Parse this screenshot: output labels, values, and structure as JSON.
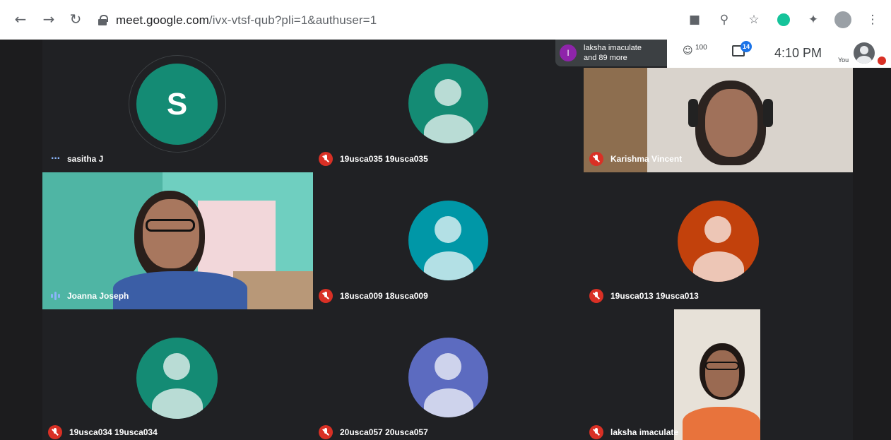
{
  "browser": {
    "url_host": "meet.google.com",
    "url_path": "/ivx-vtsf-qub?pli=1&authuser=1",
    "icons": [
      "back-arrow-icon",
      "forward-arrow-icon",
      "reload-icon",
      "lock-icon",
      "camera-icon",
      "zoom-icon",
      "star-icon",
      "grammarly-icon",
      "extensions-icon",
      "profile-icon",
      "menu-icon"
    ]
  },
  "meet": {
    "presenter": {
      "avatar_letter": "I",
      "line1": "laksha imaculate",
      "line2": "and 89 more"
    },
    "people_count": "100",
    "chat_badge": "14",
    "time": "4:10 PM",
    "you_label": "You"
  },
  "participants": [
    {
      "name": "sasitha J",
      "type": "letter",
      "letter": "S",
      "color": "#148b74",
      "status": "dots"
    },
    {
      "name": "19usca035 19usca035",
      "type": "avatar",
      "color": "#148b74",
      "status": "muted"
    },
    {
      "name": "Karishma Vincent",
      "type": "video",
      "status": "muted"
    },
    {
      "name": "Joanna Joseph",
      "type": "video",
      "status": "speaking"
    },
    {
      "name": "18usca009 18usca009",
      "type": "avatar",
      "color": "#0097a7",
      "status": "muted"
    },
    {
      "name": "19usca013 19usca013",
      "type": "avatar",
      "color": "#c2410c",
      "status": "muted"
    },
    {
      "name": "19usca034 19usca034",
      "type": "avatar",
      "color": "#148b74",
      "status": "muted"
    },
    {
      "name": "20usca057 20usca057",
      "type": "avatar",
      "color": "#5c6bc0",
      "status": "muted"
    },
    {
      "name": "laksha imaculate",
      "type": "video",
      "status": "muted"
    }
  ],
  "colors": {
    "stage_bg": "#202124",
    "muted_red": "#d93025",
    "speaking_blue": "#8ab4f8"
  }
}
